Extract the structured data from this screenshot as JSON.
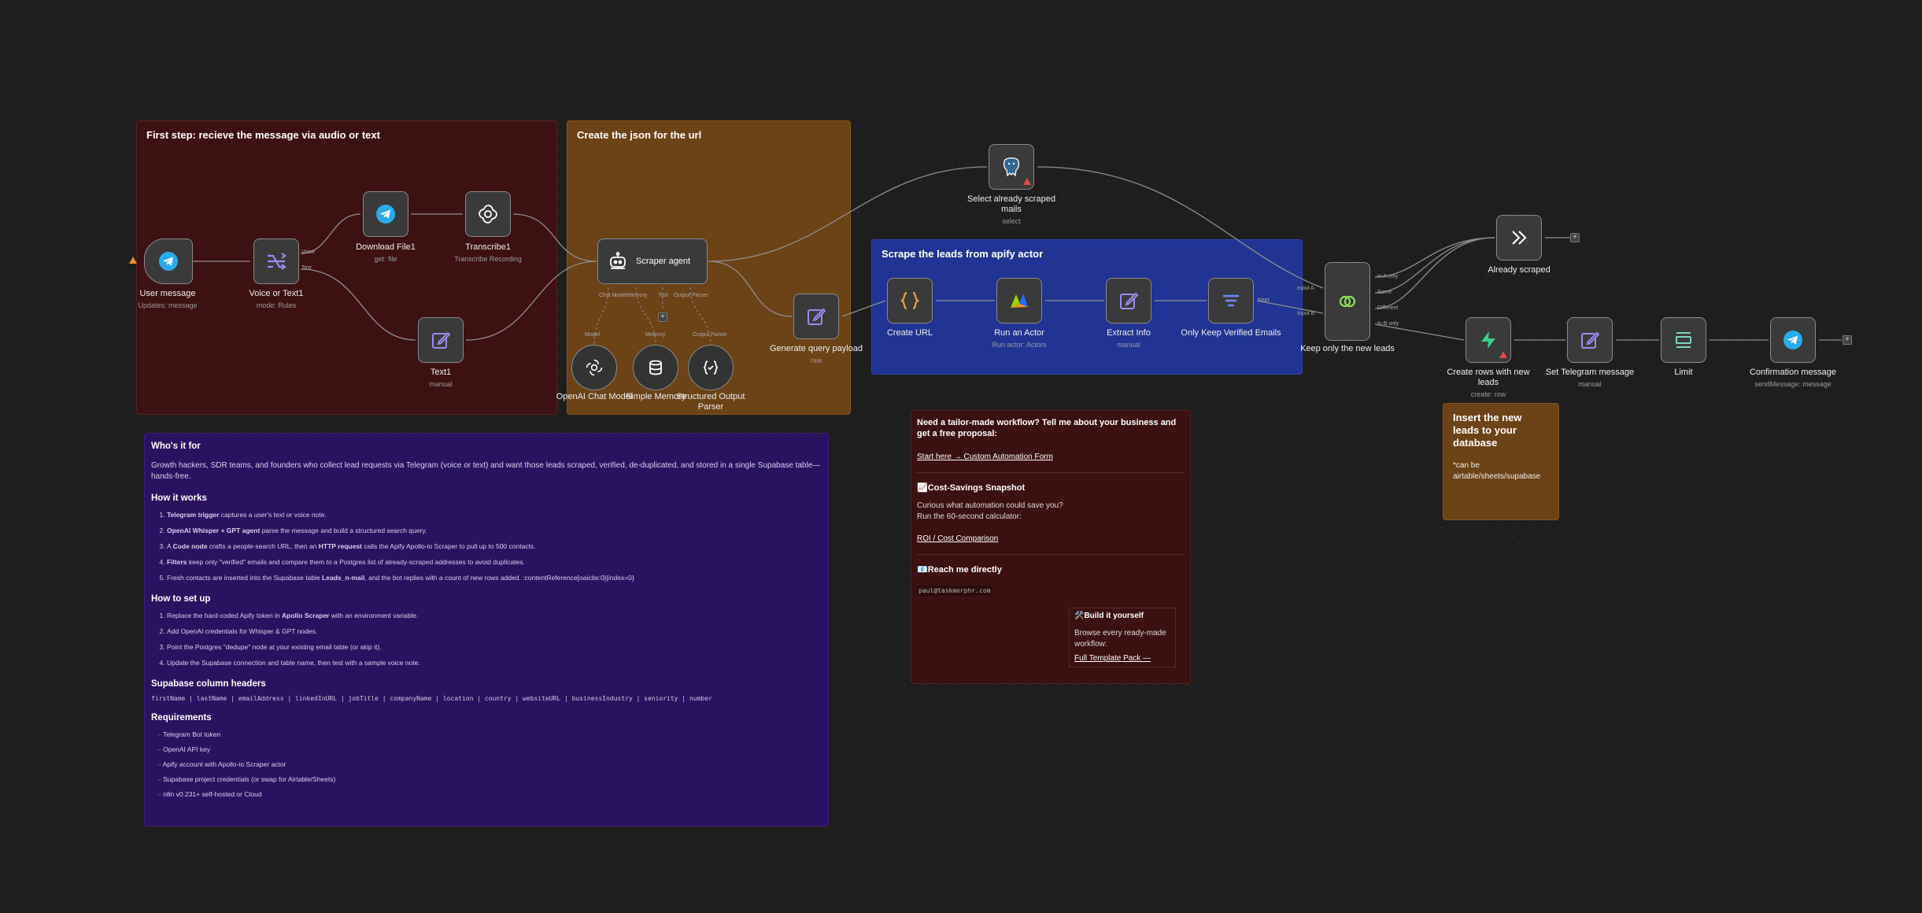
{
  "colors": {
    "canvas": "#1e1e1e",
    "sticky_red": "#3d1111",
    "sticky_orange": "#6c4217",
    "sticky_blue": "#213493",
    "sticky_purple": "#2b1261",
    "telegram": "#2aabee",
    "icon_purple": "#9a8cf0",
    "icon_green": "#3ecf8e"
  },
  "stickies": {
    "step1": "First step: recieve the message via audio or text",
    "json": "Create the json for the url",
    "apify": "Scrape the leads from apify actor",
    "insert_title": "Insert the new leads to your database",
    "insert_body": "*can be airtable/sheets/supabase"
  },
  "nodes": {
    "user_message": {
      "name": "User message",
      "sub": "Updates: message"
    },
    "voice_or_text": {
      "name": "Voice or Text1",
      "sub": "mode: Rules",
      "out1": "Voice",
      "out2": "Text"
    },
    "download_file": {
      "name": "Download File1",
      "sub": "get: file"
    },
    "transcribe": {
      "name": "Transcribe1",
      "sub": "Transcribe Recording"
    },
    "text1": {
      "name": "Text1",
      "sub": "manual"
    },
    "scraper_agent": {
      "name": "Scraper agent",
      "p1": "Chat Model",
      "p2": "Memory",
      "p3": "Tool",
      "p4": "Output Parser",
      "plus": "+"
    },
    "openai_chat": {
      "name": "OpenAI Chat Model",
      "tag": "Model"
    },
    "simple_memory": {
      "name": "Simple Memory",
      "tag": "Memory"
    },
    "structured_parser": {
      "name": "Structured Output Parser",
      "tag": "Output Parser"
    },
    "generate_payload": {
      "name": "Generate query payload",
      "sub": "raw"
    },
    "select_scraped": {
      "name": "Select already scraped mails",
      "sub": "select"
    },
    "create_url": {
      "name": "Create URL",
      "sub": ""
    },
    "run_actor": {
      "name": "Run an Actor",
      "sub": "Run actor: Actors"
    },
    "extract_info": {
      "name": "Extract Info",
      "sub": "manual"
    },
    "only_verified": {
      "name": "Only Keep Verified Emails",
      "sub": "",
      "out": "Kept"
    },
    "keep_new": {
      "name": "Keep only the new leads",
      "in1": "Input A",
      "in2": "Input B",
      "o1": "In A only",
      "o2": "Same",
      "o3": "Different",
      "o4": "In B only"
    },
    "already_scraped": {
      "name": "Already scraped",
      "plus": "+"
    },
    "create_rows": {
      "name": "Create rows with new leads",
      "sub": "create: row"
    },
    "set_telegram": {
      "name": "Set Telegram message",
      "sub": "manual"
    },
    "limit": {
      "name": "Limit",
      "sub": ""
    },
    "confirmation": {
      "name": "Confirmation message",
      "sub": "sendMessage: message",
      "plus": "+"
    }
  },
  "doc": {
    "title": "Who's it for",
    "intro": "Growth hackers, SDR teams, and founders who collect lead requests via Telegram (voice or text) and want those leads scraped, verified, de-duplicated, and stored in a single Supabase table—hands-free.",
    "how_title": "How it works",
    "how": [
      {
        "b": "Telegram trigger",
        "t": " captures a user's text or voice note."
      },
      {
        "b": "OpenAI Whisper + GPT agent",
        "t": " parse the message and build a structured search query."
      },
      {
        "pre": "A ",
        "b": "Code node",
        "t": " crafts a people-search URL, then an ",
        "b2": "HTTP request",
        "t2": " calls the Apify Apollo-io Scraper to pull up to 500 contacts."
      },
      {
        "b": "Filters",
        "t": " keep only \"verified\" emails and compare them to a Postgres list of already-scraped addresses to avoid duplicates."
      },
      {
        "pre": "Fresh contacts are inserted into the Supabase table ",
        "b": "Leads_n-mail",
        "t": ", and the bot replies with a count of new rows added. :contentReference[oaicite:0]{index=0}"
      }
    ],
    "setup_title": "How to set up",
    "setup": [
      {
        "pre": "Replace the hard-coded Apify token in ",
        "b": "Apollo Scraper",
        "t": " with an environment variable."
      },
      {
        "pre": "Add OpenAI credentials for Whisper & GPT nodes.",
        "b": "",
        "t": ""
      },
      {
        "pre": "Point the Postgres \"dedupe\" node at your existing email table (or skip it).",
        "b": "",
        "t": ""
      },
      {
        "pre": "Update the Supabase connection and table name, then test with a sample voice note.",
        "b": "",
        "t": ""
      }
    ],
    "columns_title": "Supabase column headers",
    "columns": "firstName | lastName | emailAddress | linkedInURL | jobTitle | companyName | location | country | websiteURL | businessIndustry | seniority | number",
    "req_title": "Requirements",
    "req": [
      "Telegram Bot token",
      "OpenAI API key",
      "Apify account with Apollo-io Scraper actor",
      "Supabase project credentials (or swap for Airtable/Sheets)",
      "n8n v0.231+ self-hosted or Cloud"
    ]
  },
  "promo": {
    "title": "Need a tailor-made workflow? Tell me about your business and get a free proposal:",
    "link1": "Start here → Custom Automation Form",
    "snap_title": "📈Cost-Savings Snapshot",
    "snap_p1": "Curious what automation could save you?",
    "snap_p2": "Run the 60-second calculator:",
    "link2": "ROI / Cost Comparison",
    "reach_title": "📧Reach me directly",
    "email": "paul@taskmorphr.com",
    "build_title": "🛠️Build it yourself",
    "build_p": "Browse every ready-made workflow:",
    "link3": "Full Template Pack —"
  }
}
